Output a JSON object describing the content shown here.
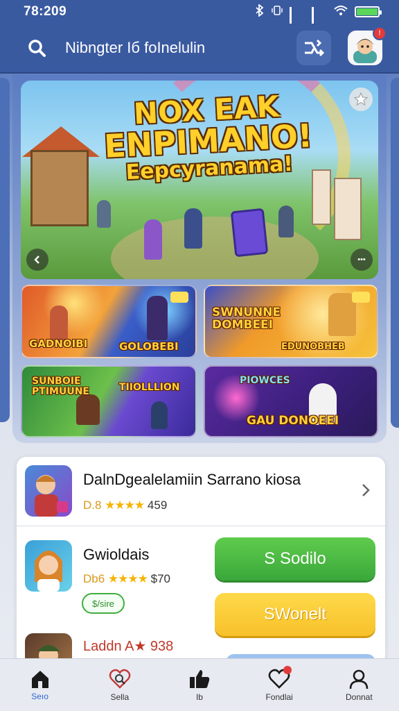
{
  "status_bar": {
    "time": "78:209"
  },
  "header": {
    "title": "Nibngter Iб foInelulin",
    "avatar_badge": "!"
  },
  "hero": {
    "title_line1": "NOX EAK",
    "title_line2": "ENPIMANO!",
    "title_line3": "Eepcyranama!",
    "next_label": "•••"
  },
  "tiles": [
    {
      "label": "GADNOIBI",
      "label2": "GOLOBEBI"
    },
    {
      "label": "SWNUNNE DOMBEEI",
      "label2": "EDUNOBHEB"
    },
    {
      "label": "SUNBOIE PTIMUUNE",
      "label2": "TIIOLLLION"
    },
    {
      "label": "PIOWCES",
      "label2": "GAU DONOEEI"
    }
  ],
  "list": {
    "row1": {
      "name": "DalnDgealelamiin Sarrano kiosa",
      "rating_prefix": "D.8",
      "stars": "★★★★",
      "rating_value": "459"
    },
    "row2": {
      "name": "Gwioldais",
      "rating_prefix": "Db6",
      "stars": "★★★★",
      "rating_value": "$70",
      "price": "$/sire"
    },
    "row3": {
      "name": "Laddn A★ 938"
    },
    "btn_green": "S Sodilo",
    "btn_yellow": "SWonelt"
  },
  "bottom_nav": [
    {
      "label": "Seıo",
      "icon": "home-icon",
      "active": true
    },
    {
      "label": "Sella",
      "icon": "heart-search-icon",
      "active": false
    },
    {
      "label": "Ib",
      "icon": "thumbs-up-icon",
      "active": false
    },
    {
      "label": "Fondlai",
      "icon": "heart-notification-icon",
      "active": false
    },
    {
      "label": "Donnat",
      "icon": "profile-icon",
      "active": false
    }
  ],
  "colors": {
    "header": "#3a5aa0",
    "accent": "#2e66d4",
    "green": "#3aa83a",
    "yellow": "#f7c12a",
    "stars": "#f4b400"
  }
}
